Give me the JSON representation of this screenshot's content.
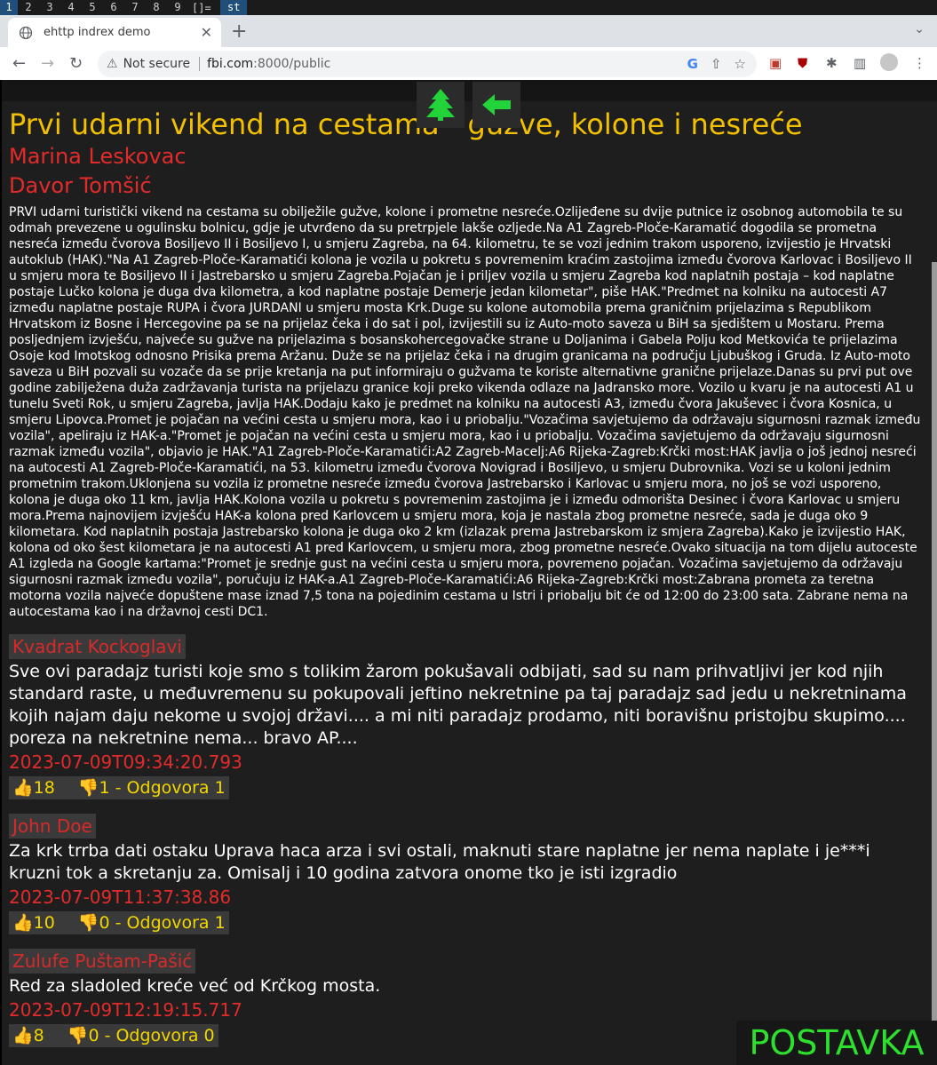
{
  "wm": {
    "workspaces": [
      "1",
      "2",
      "3",
      "4",
      "5",
      "6",
      "7",
      "8",
      "9"
    ],
    "layout": "[]=",
    "window_title": "st"
  },
  "browser": {
    "tab_title": "ehttp indrex demo",
    "security_label": "Not secure",
    "url_host": "fbi.com",
    "url_rest": ":8000/public"
  },
  "toolbar_buttons": {
    "tree_button": "tree-icon",
    "back_button": "arrow-left-icon"
  },
  "article": {
    "title": "Prvi udarni vikend na cestama - gužve, kolone i nesreće",
    "authors": [
      "Marina Leskovac",
      "Davor Tomšić"
    ],
    "body": "PRVI udarni turistički vikend na cestama su obilježile gužve, kolone i prometne nesreće.Ozlijeđene su dvije putnice iz osobnog automobila te su odmah prevezene u ogulinsku bolnicu, gdje je utvrđeno da su pretrpjele lakše ozljede.Na A1 Zagreb-Ploče-Karamatić dogodila se prometna nesreća između čvorova Bosiljevo II i Bosiljevo I, u smjeru Zagreba, na 64. kilometru, te se vozi jednim trakom usporeno, izvijestio je Hrvatski autoklub (HAK).\"Na A1 Zagreb-Ploče-Karamatići kolona je vozila u pokretu s povremenim kraćim zastojima između čvorova Karlovac i Bosiljevo II u smjeru mora te Bosiljevo II i Jastrebarsko u smjeru Zagreba.Pojačan je i priljev vozila u smjeru Zagreba kod naplatnih postaja – kod naplatne postaje Lučko kolona je duga dva kilometra, a kod naplatne postaje Demerje jedan kilometar\", piše HAK.\"Predmet na kolniku na autocesti A7 između naplatne postaje RUPA i čvora JURDANI u smjeru mosta Krk.Duge su kolone automobila prema graničnim prijelazima s Republikom Hrvatskom iz Bosne i Hercegovine pa se na prijelaz čeka i do sat i pol, izvijestili su iz Auto-moto saveza u BiH sa sjedištem u Mostaru. Prema posljednjem izvješću, najveće su gužve na prijelazima s bosanskohercegovačke strane u Doljanima i Gabela Polju kod Metkovića te prijelazima Osoje kod Imotskog odnosno Prisika prema Aržanu. Duže se na prijelaz čeka i na drugim granicama na području Ljubuškog i Gruda. Iz Auto-moto saveza u BiH pozvali su vozače da se prije kretanja na put informiraju o gužvama te koriste alternativne granične prijelaze.Danas su prvi put ove godine zabilježena duža zadržavanja turista na prijelazu granice koji preko vikenda odlaze na Jadransko more. Vozilo u kvaru je na autocesti A1 u tunelu Sveti Rok, u smjeru Zagreba, javlja HAK.Dodaju kako je predmet na kolniku na autocesti A3, između čvora Jakuševec i čvora Kosnica, u smjeru Lipovca.Promet je pojačan na većini cesta u smjeru mora, kao i u priobalju.\"Vozačima savjetujemo da održavaju sigurnosni razmak između vozila\", apeliraju iz HAK-a.\"Promet je pojačan na većini cesta u smjeru mora, kao i u priobalju. Vozačima savjetujemo da održavaju sigurnosni razmak između vozila\", objavio je HAK.\"A1 Zagreb-Ploče-Karamatići:A2 Zagreb-Macelj:A6 Rijeka-Zagreb:Krčki most:HAK javlja o još jednoj nesreći na autocesti A1 Zagreb-Ploče-Karamatići, na 53. kilometru između čvorova Novigrad i Bosiljevo, u smjeru Dubrovnika. Vozi se u koloni jednim prometnim trakom.Uklonjena su vozila iz prometne nesreće između čvorova Jastrebarsko i Karlovac u smjeru mora, no još se vozi usporeno, kolona je duga oko 11 km, javlja HAK.Kolona vozila u pokretu s povremenim zastojima je i između odmorišta Desinec i čvora Karlovac u smjeru mora.Prema najnovijem izvješću HAK-a kolona pred Karlovcem u smjeru mora, koja je nastala zbog prometne nesreće, sada je duga oko 9 kilometara. Kod naplatnih postaja Jastrebarsko kolona je duga oko 2 km (izlazak prema Jastrebarskom iz smjera Zagreba).Kako je izvijestio HAK, kolona od oko šest kilometara je na autocesti A1 pred Karlovcem, u smjeru mora, zbog prometne nesreće.Ovako situacija na tom dijelu autoceste A1 izgleda na Google kartama:\"Promet je srednje gust na većini cesta u smjeru mora, povremeno pojačan. Vozačima savjetujemo da održavaju sigurnosni razmak između vozila\", poručuju iz HAK-a.A1 Zagreb-Ploče-Karamatići:A6 Rijeka-Zagreb:Krčki most:Zabrana prometa za teretna motorna vozila najveće dopuštene mase iznad 7,5 tona na pojedinim cestama u Istri i priobalju bit će od 12:00 do 23:00 sata. Zabrane nema na autocestama kao i na državnoj cesti DC1."
  },
  "comments": [
    {
      "author": "Kvadrat Kockoglavi",
      "text": "Sve ovi paradajz turisti koje smo s tolikim žarom pokušavali odbijati, sad su nam prihvatljivi jer kod njih standard raste, u međuvremenu su pokupovali jeftino nekretnine pa taj paradajz sad jedu u nekretninama kojih najam daju nekome u svojoj državi.... a mi niti paradajz prodamo, niti boravišnu pristojbu skupimo.... poreza na nekretnine nema... bravo AP....",
      "date": "2023-07-09T09:34:20.793",
      "likes": "18",
      "dislikes": "1 - Odgovora 1"
    },
    {
      "author": "John Doe",
      "text": "Za krk trrba dati ostaku Uprava haca arza i svi ostali, maknuti stare naplatne jer nema naplate i je***i kruzni tok  a skretanju za. Omisalj i 10 godina zatvora onome tko je isti izgradio",
      "date": "2023-07-09T11:37:38.86",
      "likes": "10",
      "dislikes": "0 - Odgovora 1"
    },
    {
      "author": "Zulufe Puštam-Pašić",
      "text": "Red za sladoled  kreće već od Krčkog mosta.",
      "date": "2023-07-09T12:19:15.717",
      "likes": "8",
      "dislikes": "0 - Odgovora 0"
    }
  ],
  "postavka_label": "POSTAVKA",
  "colors": {
    "headline": "#f2c000",
    "author": "#e32b2b",
    "background": "#1e1e1e",
    "postavka": "#2ee02e",
    "tree_icon": "#22d33a"
  }
}
